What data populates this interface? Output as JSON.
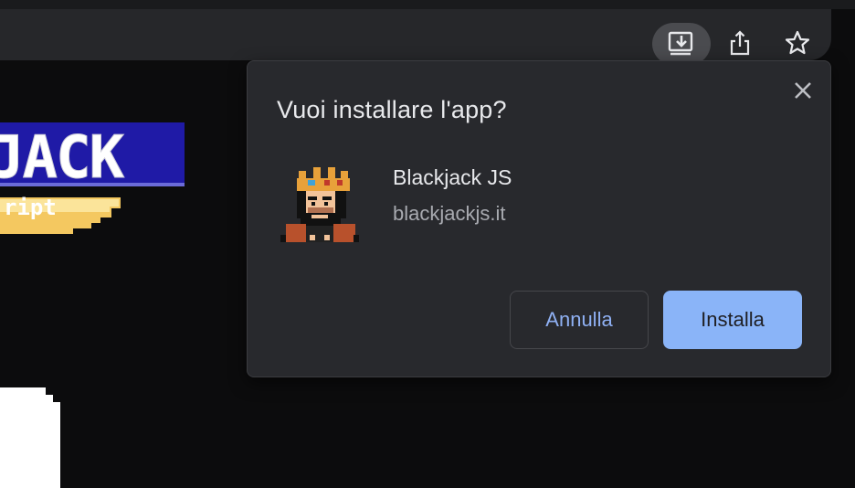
{
  "toolbar": {
    "install_icon": "install-app-icon",
    "share_icon": "share-icon",
    "star_icon": "bookmark-star-icon"
  },
  "page": {
    "logo_text": "JACK",
    "logo_subtext": "ript"
  },
  "dialog": {
    "title": "Vuoi installare l'app?",
    "close_icon": "close-icon",
    "app_name": "Blackjack JS",
    "app_url": "blackjackjs.it",
    "cancel_label": "Annulla",
    "install_label": "Installa"
  },
  "colors": {
    "accent": "#8ab4f8",
    "dialog_bg": "#28292d",
    "toolbar_bg": "#26272a",
    "page_bg": "#0c0c0d"
  }
}
